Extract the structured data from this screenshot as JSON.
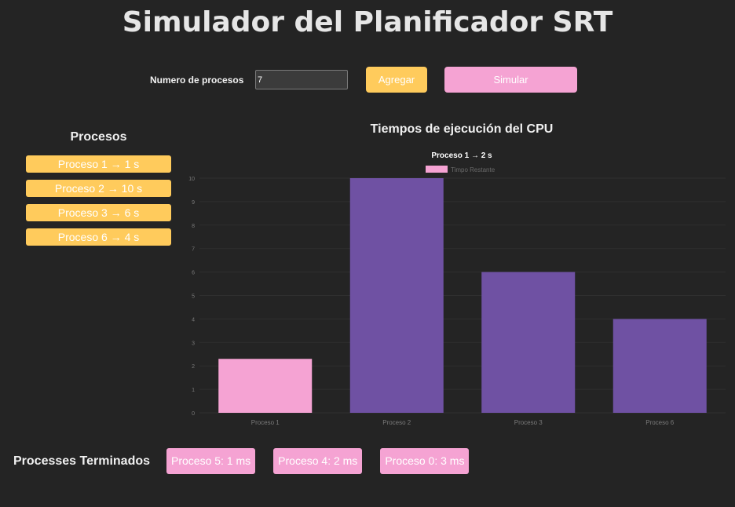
{
  "page": {
    "title": "Simulador del Planificador SRT"
  },
  "controls": {
    "count_label": "Numero de procesos",
    "count_value": "7",
    "add_label": "Agregar",
    "simulate_label": "Simular"
  },
  "processes": {
    "heading": "Procesos",
    "items": [
      "Proceso 1 → 1 s",
      "Proceso 2 → 10 s",
      "Proceso 3 → 6 s",
      "Proceso 6 → 4 s"
    ]
  },
  "chart_section": {
    "heading": "Tiempos de ejecución del CPU"
  },
  "chart_data": {
    "type": "bar",
    "title": "Proceso 1 → 2 s",
    "categories": [
      "Proceso 1",
      "Proceso 2",
      "Proceso 3",
      "Proceso 6"
    ],
    "series": [
      {
        "name": "Timpo Restante",
        "values": [
          2.3,
          10,
          6,
          4
        ]
      }
    ],
    "bar_colors": [
      "#f5a3d3",
      "#6f51a3",
      "#6f51a3",
      "#6f51a3"
    ],
    "legend_color": "#f5a3d3",
    "yticks": [
      0,
      1,
      2,
      3,
      4,
      5,
      6,
      7,
      8,
      9,
      10
    ],
    "ylim": [
      0,
      10
    ],
    "grid": true,
    "legend_position": "top"
  },
  "finished": {
    "heading": "Processes Terminados",
    "items": [
      "Proceso 5: 1 ms",
      "Proceso 4: 2 ms",
      "Proceso 0: 3 ms"
    ]
  },
  "colors": {
    "background": "#242424",
    "accent_yellow": "#ffcb5c",
    "accent_pink": "#f5a3d3",
    "bar_purple": "#6f51a3"
  }
}
